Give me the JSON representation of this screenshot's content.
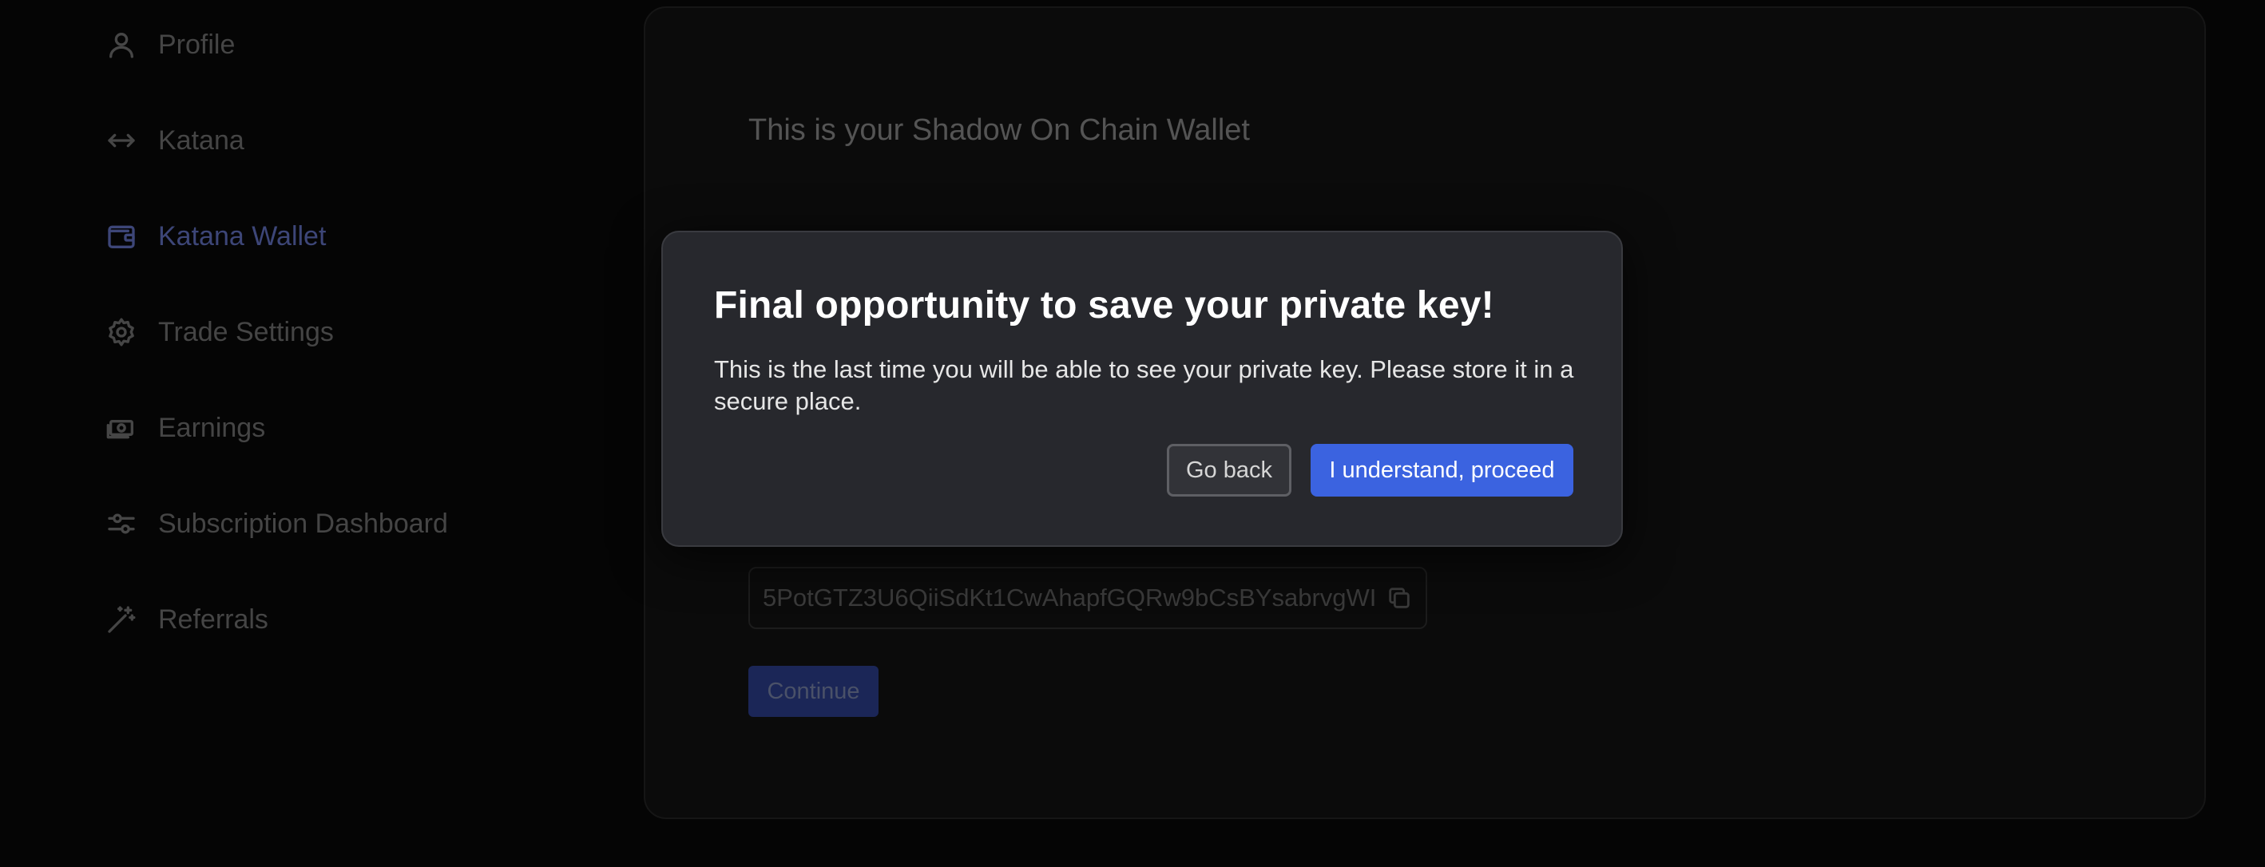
{
  "sidebar": {
    "items": [
      {
        "label": "Profile",
        "icon": "user-icon"
      },
      {
        "label": "Katana",
        "icon": "arrows-horizontal-icon"
      },
      {
        "label": "Katana Wallet",
        "icon": "wallet-icon",
        "active": true
      },
      {
        "label": "Trade Settings",
        "icon": "gear-icon"
      },
      {
        "label": "Earnings",
        "icon": "cash-icon"
      },
      {
        "label": "Subscription Dashboard",
        "icon": "sliders-icon"
      },
      {
        "label": "Referrals",
        "icon": "magic-wand-icon"
      }
    ]
  },
  "main": {
    "title": "This is your Shadow On Chain Wallet",
    "private_key_value": "5PotGTZ3U6QiiSdKt1CwAhapfGQRw9bCsBYsabrvgWI",
    "copy_icon": "copy-icon",
    "continue_label": "Continue"
  },
  "modal": {
    "title": "Final opportunity to save your private key!",
    "body": "This is the last time you will be able to see your private key. Please store it in a secure place.",
    "back_label": "Go back",
    "proceed_label": "I understand, proceed"
  },
  "colors": {
    "background": "#050505",
    "panel": "#0b0b0b",
    "modal": "#27282d",
    "accent": "#3b63e0",
    "active_nav": "#3d4678"
  }
}
